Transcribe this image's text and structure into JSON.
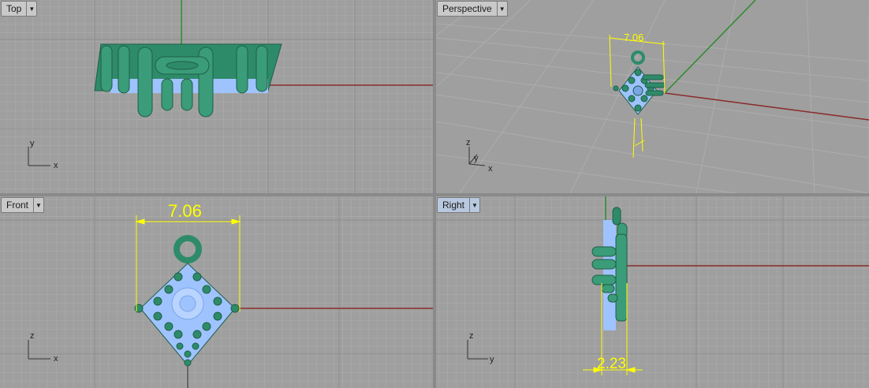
{
  "viewports": {
    "top": {
      "label": "Top",
      "axis_x": "x",
      "axis_y": "y"
    },
    "perspective": {
      "label": "Perspective",
      "dimension": "7.06",
      "axis_x": "x",
      "axis_y": "y",
      "axis_z": "z"
    },
    "front": {
      "label": "Front",
      "dimension": "7.06",
      "axis_x": "x",
      "axis_z": "z"
    },
    "right": {
      "label": "Right",
      "dimension": "2.23",
      "axis_y": "y",
      "axis_z": "z"
    }
  },
  "colors": {
    "viewport_bg": "#9f9f9f",
    "grid_minor": "#aaaaaa",
    "grid_major": "#8c8c8c",
    "x_axis": "#8b2a2a",
    "y_axis": "#2a8b2a",
    "model_green": "#2e8b6a",
    "model_blue": "#9fc3ff",
    "dimension": "#ffff00",
    "active_tab": "#b8c8de"
  },
  "dropdown_icon": "triangle-down-icon"
}
